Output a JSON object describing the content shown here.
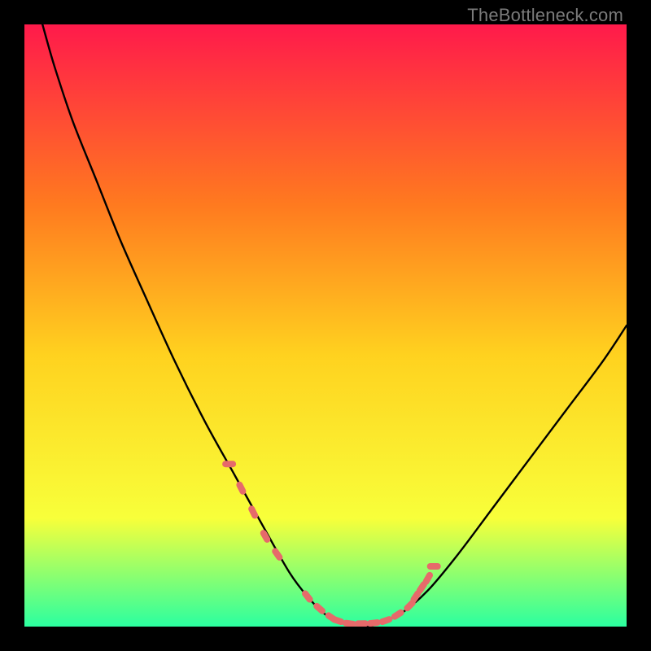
{
  "watermark": "TheBottleneck.com",
  "colors": {
    "background": "#000000",
    "gradient_top": "#ff1a4b",
    "gradient_mid1": "#ff7a1f",
    "gradient_mid2": "#ffd21f",
    "gradient_mid3": "#f8ff3a",
    "gradient_bottom": "#2bffa0",
    "curve": "#000000",
    "marker": "#e66a6a",
    "watermark": "#7a7a7a"
  },
  "chart_data": {
    "type": "line",
    "title": "",
    "xlabel": "",
    "ylabel": "",
    "xlim": [
      0,
      100
    ],
    "ylim": [
      0,
      100
    ],
    "grid": false,
    "legend": false,
    "series": [
      {
        "name": "bottleneck-curve",
        "x": [
          3,
          5,
          8,
          12,
          16,
          20,
          25,
          30,
          35,
          40,
          44,
          47,
          50,
          53,
          56,
          58,
          60,
          63,
          67,
          72,
          78,
          84,
          90,
          96,
          100
        ],
        "values": [
          100,
          93,
          84,
          74,
          64,
          55,
          44,
          34,
          25,
          16,
          9,
          5,
          2,
          0.5,
          0.2,
          0.2,
          1,
          2.5,
          6,
          12,
          20,
          28,
          36,
          44,
          50
        ]
      }
    ],
    "markers": {
      "name": "highlighted-points",
      "x": [
        34,
        36,
        38,
        40,
        42,
        47,
        49,
        51,
        52,
        54,
        56,
        58,
        60,
        62,
        64,
        65,
        66,
        67,
        68
      ],
      "values": [
        27,
        23,
        19,
        15,
        12,
        5,
        3,
        1.5,
        1,
        0.5,
        0.5,
        0.6,
        1,
        2,
        3.5,
        5,
        6.5,
        8,
        10
      ]
    }
  }
}
